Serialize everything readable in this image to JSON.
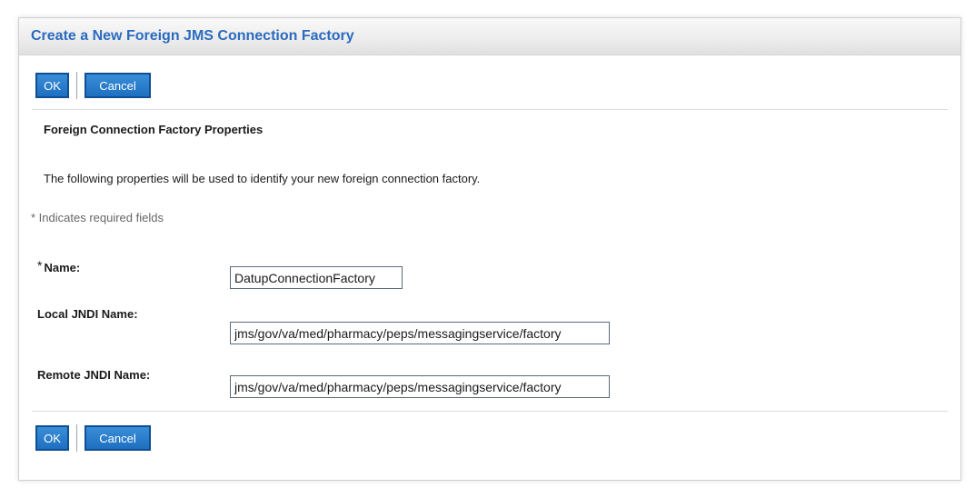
{
  "page": {
    "title": "Create a New Foreign JMS Connection Factory"
  },
  "buttons": {
    "ok_label": "OK",
    "cancel_label": "Cancel"
  },
  "section": {
    "title": "Foreign Connection Factory Properties",
    "description": "The following properties will be used to identify your new foreign connection factory.",
    "required_note": "* Indicates required fields"
  },
  "fields": {
    "name": {
      "required_marker": "*",
      "label": "Name:",
      "value": "DatupConnectionFactory"
    },
    "local_jndi": {
      "label": "Local JNDI Name:",
      "value": "jms/gov/va/med/pharmacy/peps/messagingservice/factory"
    },
    "remote_jndi": {
      "label": "Remote JNDI Name:",
      "value": "jms/gov/va/med/pharmacy/peps/messagingservice/factory"
    }
  },
  "colors": {
    "title_text": "#2a6bc0",
    "button_bg": "#1e6fc1",
    "button_border": "#0e4f95"
  }
}
